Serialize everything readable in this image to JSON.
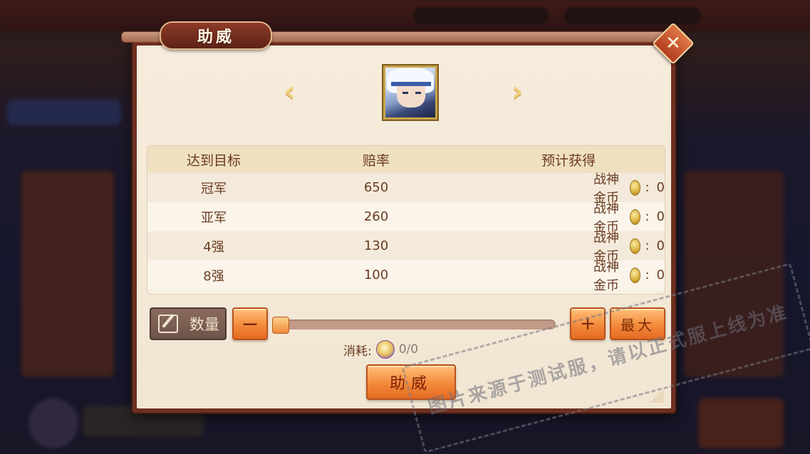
{
  "dialog": {
    "title": "助威",
    "close_icon": "close-icon"
  },
  "hero_selector": {
    "prev_icon": "chevron-left-icon",
    "next_icon": "chevron-right-icon",
    "portrait": "hero-portrait-silver-hair"
  },
  "table": {
    "headers": [
      "达到目标",
      "赔率",
      "预计获得"
    ],
    "rows": [
      {
        "target": "冠军",
        "odds": "650",
        "reward_label": "战神金币",
        "separator": ":",
        "reward_value": "0"
      },
      {
        "target": "亚军",
        "odds": "260",
        "reward_label": "战神金币",
        "separator": ":",
        "reward_value": "0"
      },
      {
        "target": "4强",
        "odds": "130",
        "reward_label": "战神金币",
        "separator": ":",
        "reward_value": "0"
      },
      {
        "target": "8强",
        "odds": "100",
        "reward_label": "战神金币",
        "separator": ":",
        "reward_value": "0"
      }
    ],
    "coin_icon": "gold-coin-icon"
  },
  "quantity": {
    "label": "数量",
    "minus": "−",
    "plus": "+",
    "max": "最大",
    "slider_fraction": 0
  },
  "cost": {
    "label": "消耗:",
    "value": "0/0",
    "token_icon": "support-token-icon"
  },
  "support_button": "助威",
  "watermark": "图片来源于测试服，请以正式服上线为准",
  "colors": {
    "accent_orange": "#f38a3a",
    "panel_bg": "#f2e6d3",
    "frame_brown": "#6e2f20",
    "text_brown": "#6a3c22"
  }
}
